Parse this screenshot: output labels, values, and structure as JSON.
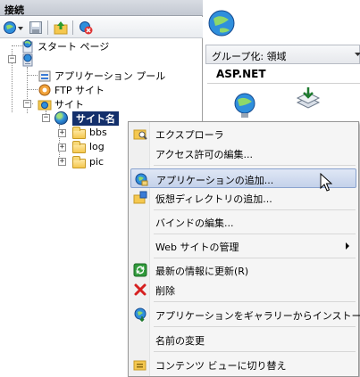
{
  "connections_pane": {
    "title": "接続",
    "tree": {
      "start_page": "スタート ページ",
      "app_pools": "アプリケーション プール",
      "ftp_sites": "FTP サイト",
      "sites": "サイト",
      "site_name": "サイト名",
      "folders": [
        "bbs",
        "log",
        "pic"
      ]
    }
  },
  "right_area": {
    "group_by_label": "グループ化: 領域",
    "section_title": "ASP.NET"
  },
  "context_menu": {
    "items": {
      "explore": "エクスプローラ",
      "edit_permissions": "アクセス許可の編集...",
      "add_application": "アプリケーションの追加...",
      "add_virtual_dir": "仮想ディレクトリの追加...",
      "edit_bindings": "バインドの編集...",
      "manage_website": "Web サイトの管理",
      "refresh": "最新の情報に更新(R)",
      "delete": "削除",
      "install_from_gallery": "アプリケーションをギャラリーからインストール",
      "rename": "名前の変更",
      "switch_content_view": "コンテンツ ビューに切り替え"
    },
    "highlighted": "add_application"
  }
}
